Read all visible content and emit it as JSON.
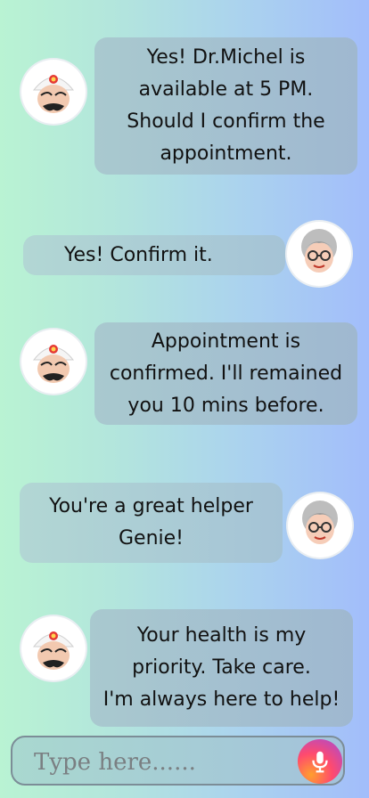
{
  "conversation": {
    "messages": [
      {
        "sender": "genie",
        "text": "Yes! Dr.Michel is\navailable at 5 PM.\nShould I confirm the\nappointment."
      },
      {
        "sender": "user",
        "text": "Yes! Confirm it."
      },
      {
        "sender": "genie",
        "text": "Appointment is\nconfirmed. I'll remained\nyou 10 mins before."
      },
      {
        "sender": "user",
        "text": "You're a great helper\nGenie!"
      },
      {
        "sender": "genie",
        "text": "Your health is my\npriority. Take care.\nI'm always here to help!"
      }
    ]
  },
  "composer": {
    "placeholder": "Type here......",
    "value": "",
    "mic_icon": "microphone-icon"
  },
  "avatars": {
    "genie_icon": "genie-avatar",
    "user_icon": "grandma-avatar"
  },
  "colors": {
    "background_left": "#b9f3d3",
    "background_right": "#a2bdfb",
    "bubble": "#a6c2d1",
    "mic_gradient": [
      "#ff9f2e",
      "#ff4a6e",
      "#a44bd8"
    ]
  }
}
